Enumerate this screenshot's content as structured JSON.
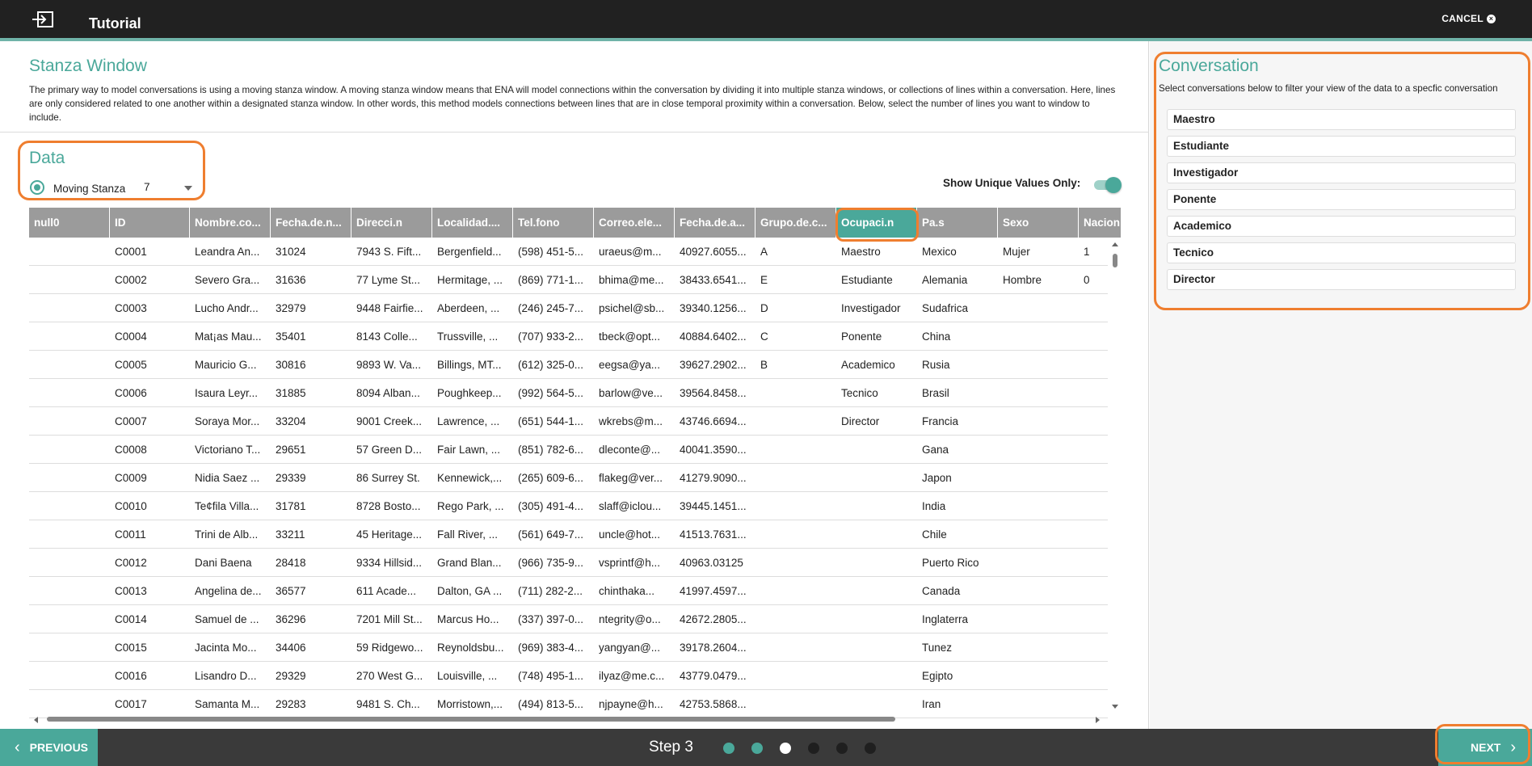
{
  "header": {
    "title": "Tutorial",
    "cancel_label": "CANCEL"
  },
  "stanza": {
    "title": "Stanza Window",
    "description": "The primary way to model conversations is using a moving stanza window. A moving stanza window means that ENA will model connections within the conversation by dividing it into multiple stanza windows, or collections of lines within a conversation. Here, lines are only considered related to one another within a designated stanza window. In other words, this method models connections between lines that are in close temporal proximity within a conversation. Below, select the number of lines you want to window to include."
  },
  "data_section": {
    "title": "Data",
    "option_label": "Moving Stanza",
    "window_value": "7",
    "unique_label": "Show Unique Values Only:"
  },
  "table": {
    "columns": [
      "null0",
      "ID",
      "Nombre.co...",
      "Fecha.de.n...",
      "Direcci.n",
      "Localidad....",
      "Tel.fono",
      "Correo.ele...",
      "Fecha.de.a...",
      "Grupo.de.c...",
      "Ocupaci.n",
      "Pa.s",
      "Sexo",
      "Nacion"
    ],
    "rows": [
      [
        "",
        "C0001",
        "Leandra An...",
        "31024",
        "7943 S. Fift...",
        "Bergenfield...",
        "(598) 451-5...",
        "uraeus@m...",
        "40927.6055...",
        "A",
        "Maestro",
        "Mexico",
        "Mujer",
        "1"
      ],
      [
        "",
        "C0002",
        "Severo Gra...",
        "31636",
        "77 Lyme St...",
        "Hermitage, ...",
        "(869) 771-1...",
        "bhima@me...",
        "38433.6541...",
        "E",
        "Estudiante",
        "Alemania",
        "Hombre",
        "0"
      ],
      [
        "",
        "C0003",
        "Lucho Andr...",
        "32979",
        "9448 Fairfie...",
        "Aberdeen, ...",
        "(246) 245-7...",
        "psichel@sb...",
        "39340.1256...",
        "D",
        "Investigador",
        "Sudafrica",
        "",
        ""
      ],
      [
        "",
        "C0004",
        "Mat¡as Mau...",
        "35401",
        "8143 Colle...",
        "Trussville, ...",
        "(707) 933-2...",
        "tbeck@opt...",
        "40884.6402...",
        "C",
        "Ponente",
        "China",
        "",
        ""
      ],
      [
        "",
        "C0005",
        "Mauricio G...",
        "30816",
        "9893 W. Va...",
        "Billings, MT...",
        "(612) 325-0...",
        "eegsa@ya...",
        "39627.2902...",
        "B",
        "Academico",
        "Rusia",
        "",
        ""
      ],
      [
        "",
        "C0006",
        "Isaura Leyr...",
        "31885",
        "8094 Alban...",
        "Poughkeep...",
        "(992) 564-5...",
        "barlow@ve...",
        "39564.8458...",
        "",
        "Tecnico",
        "Brasil",
        "",
        ""
      ],
      [
        "",
        "C0007",
        "Soraya Mor...",
        "33204",
        "9001 Creek...",
        "Lawrence, ...",
        "(651) 544-1...",
        "wkrebs@m...",
        "43746.6694...",
        "",
        "Director",
        "Francia",
        "",
        ""
      ],
      [
        "",
        "C0008",
        "Victoriano T...",
        "29651",
        "57 Green D...",
        "Fair Lawn, ...",
        "(851) 782-6...",
        "dleconte@...",
        "40041.3590...",
        "",
        "",
        "Gana",
        "",
        ""
      ],
      [
        "",
        "C0009",
        "Nidia Saez ...",
        "29339",
        "86 Surrey St.",
        "Kennewick,...",
        "(265) 609-6...",
        "flakeg@ver...",
        "41279.9090...",
        "",
        "",
        "Japon",
        "",
        ""
      ],
      [
        "",
        "C0010",
        "Te¢fila Villa...",
        "31781",
        "8728 Bosto...",
        "Rego Park, ...",
        "(305) 491-4...",
        "slaff@iclou...",
        "39445.1451...",
        "",
        "",
        "India",
        "",
        ""
      ],
      [
        "",
        "C0011",
        "Trini de Alb...",
        "33211",
        "45 Heritage...",
        "Fall River, ...",
        "(561) 649-7...",
        "uncle@hot...",
        "41513.7631...",
        "",
        "",
        "Chile",
        "",
        ""
      ],
      [
        "",
        "C0012",
        "Dani Baena",
        "28418",
        "9334 Hillsid...",
        "Grand Blan...",
        "(966) 735-9...",
        "vsprintf@h...",
        "40963.03125",
        "",
        "",
        "Puerto Rico",
        "",
        ""
      ],
      [
        "",
        "C0013",
        "Angelina de...",
        "36577",
        "611 Acade...",
        "Dalton, GA ...",
        "(711) 282-2...",
        "chinthaka...",
        "41997.4597...",
        "",
        "",
        "Canada",
        "",
        ""
      ],
      [
        "",
        "C0014",
        "Samuel de ...",
        "36296",
        "7201 Mill St...",
        "Marcus Ho...",
        "(337) 397-0...",
        "ntegrity@o...",
        "42672.2805...",
        "",
        "",
        "Inglaterra",
        "",
        ""
      ],
      [
        "",
        "C0015",
        "Jacinta Mo...",
        "34406",
        "59 Ridgewo...",
        "Reynoldsbu...",
        "(969) 383-4...",
        "yangyan@...",
        "39178.2604...",
        "",
        "",
        "Tunez",
        "",
        ""
      ],
      [
        "",
        "C0016",
        "Lisandro D...",
        "29329",
        "270 West G...",
        "Louisville, ...",
        "(748) 495-1...",
        "ilyaz@me.c...",
        "43779.0479...",
        "",
        "",
        "Egipto",
        "",
        ""
      ],
      [
        "",
        "C0017",
        "Samanta M...",
        "29283",
        "9481 S. Ch...",
        "Morristown,...",
        "(494) 813-5...",
        "njpayne@h...",
        "42753.5868...",
        "",
        "",
        "Iran",
        "",
        ""
      ]
    ]
  },
  "conversation": {
    "title": "Conversation",
    "description": "Select conversations below to filter your view of the data to a specfic conversation",
    "items": [
      "Maestro",
      "Estudiante",
      "Investigador",
      "Ponente",
      "Academico",
      "Tecnico",
      "Director"
    ]
  },
  "footer": {
    "previous_label": "PREVIOUS",
    "next_label": "NEXT",
    "step_label": "Step 3",
    "total_steps": 6,
    "current_step": 3
  },
  "colors": {
    "accent": "#4aa89a",
    "highlight": "#ef7e2f",
    "dot_done": "#4aa89a",
    "dot_current": "#ffffff",
    "dot_pending": "#1f1f1f"
  }
}
